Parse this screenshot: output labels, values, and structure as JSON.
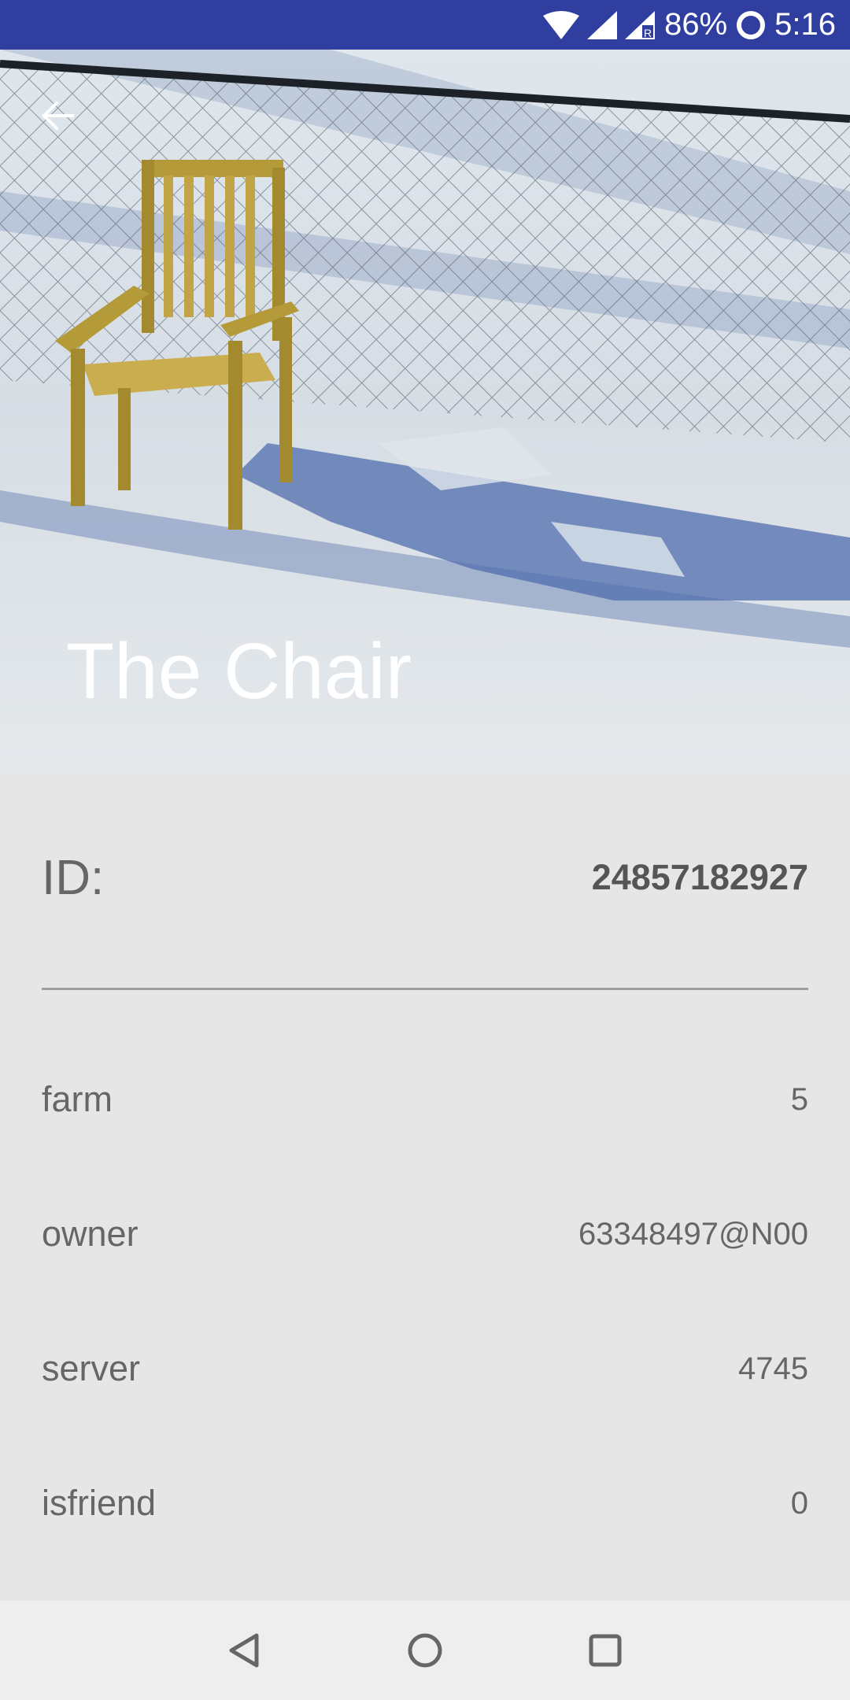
{
  "status_bar": {
    "battery": "86%",
    "time": "5:16",
    "icons": [
      "wifi-icon",
      "signal-icon",
      "signal-roaming-icon",
      "battery-saver-icon"
    ]
  },
  "hero": {
    "title": "The Chair",
    "back_icon": "arrow-back-icon"
  },
  "details": {
    "id_label": "ID:",
    "id_value": "24857182927",
    "fields": [
      {
        "label": "farm",
        "value": "5"
      },
      {
        "label": "owner",
        "value": "63348497@N00"
      },
      {
        "label": "server",
        "value": "4745"
      },
      {
        "label": "isfriend",
        "value": "0"
      }
    ]
  },
  "nav_bar": {
    "buttons": [
      "back-triangle-icon",
      "home-circle-icon",
      "recents-square-icon"
    ]
  },
  "colors": {
    "status_bar": "#303f9f",
    "content_background": "#e6e6e6",
    "text": "#666666",
    "nav_bar": "#eeeeee"
  }
}
